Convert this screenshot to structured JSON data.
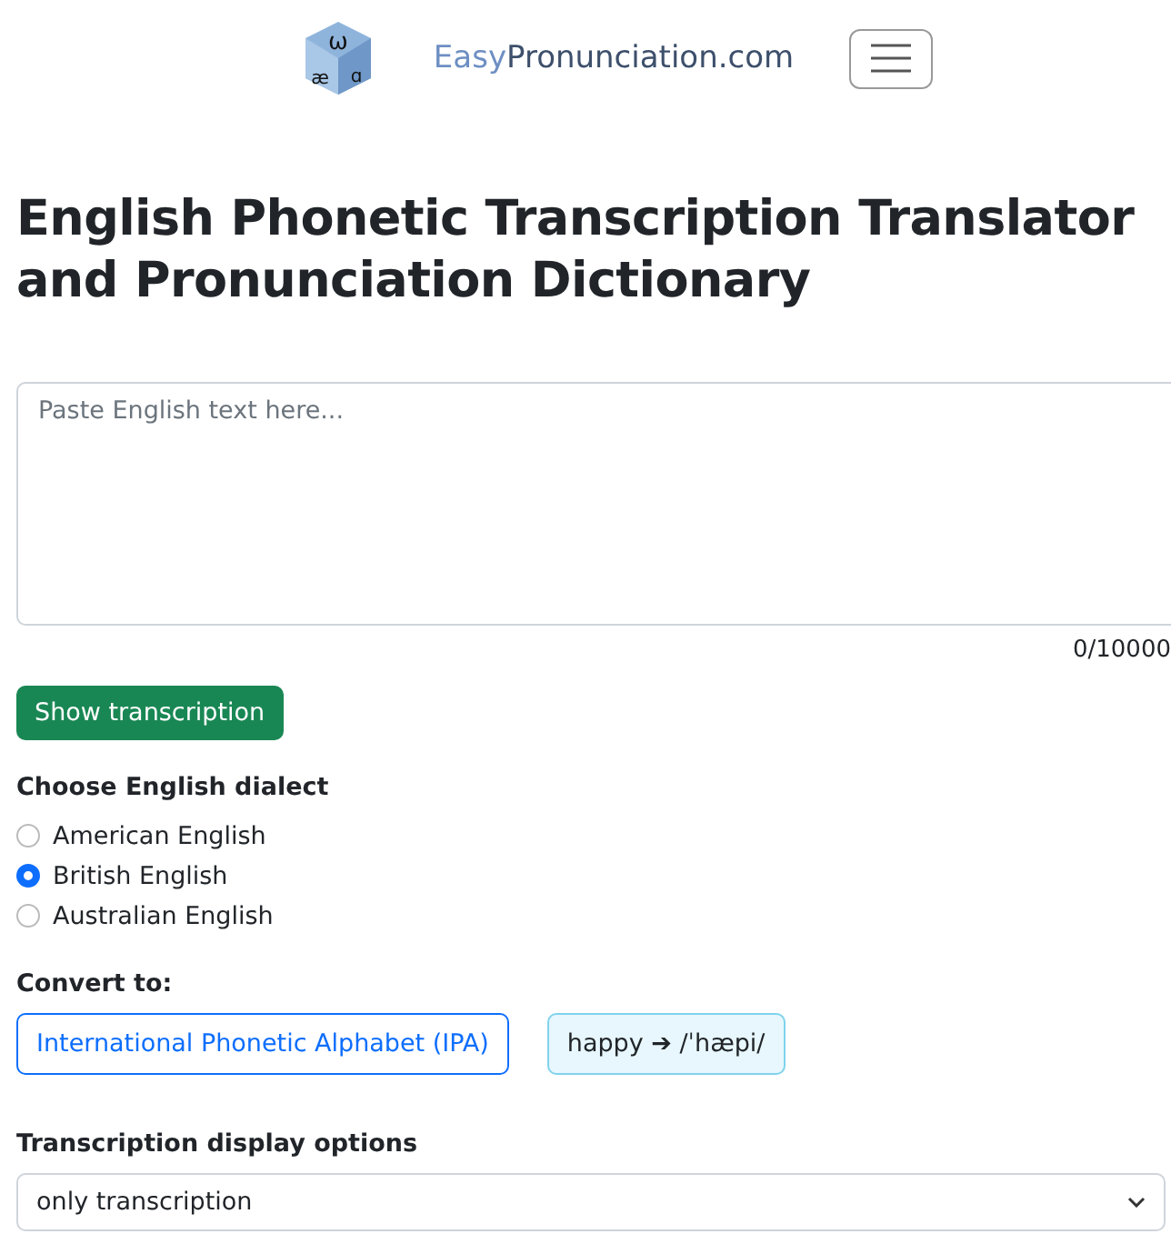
{
  "header": {
    "logo_glyphs": [
      "ω",
      "æ",
      "ɑ"
    ],
    "logo_text": [
      "Easy",
      "Pronunciation.com"
    ]
  },
  "title": "English Phonetic Transcription Translator and Pronunciation Dictionary",
  "text_input": {
    "placeholder": "Paste English text here...",
    "counter": "0/10000"
  },
  "submit_button": "Show transcription",
  "dialect": {
    "label": "Choose English dialect",
    "options": [
      {
        "label": "American English",
        "selected": false
      },
      {
        "label": "British English",
        "selected": true
      },
      {
        "label": "Australian English",
        "selected": false
      }
    ]
  },
  "convert": {
    "label": "Convert to:",
    "options": [
      {
        "kind": "outline",
        "label": "International Phonetic Alphabet (IPA)"
      },
      {
        "kind": "example",
        "label": "happy ➔ /ˈhæpi/"
      }
    ]
  },
  "display_options": {
    "label": "Transcription display options",
    "value": "only transcription"
  }
}
